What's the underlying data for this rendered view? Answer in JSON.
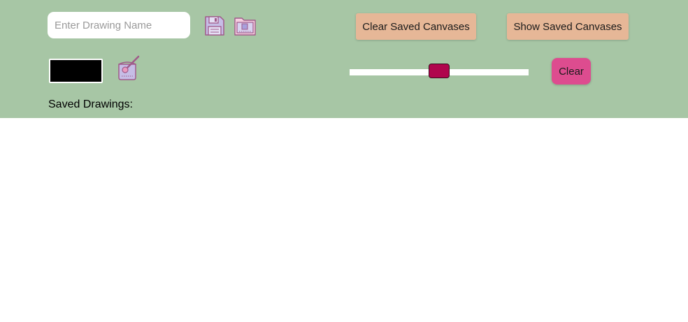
{
  "toolbar": {
    "name_input": {
      "value": "",
      "placeholder": "Enter Drawing Name"
    },
    "save_icon": "floppy-disk-icon",
    "load_icon": "open-folder-icon",
    "clear_saved_label": "Clear Saved Canvases",
    "show_saved_label": "Show Saved Canvases",
    "color_value": "#000000",
    "bucket_icon": "paint-bucket-icon",
    "brush_size_fraction": 0.5,
    "clear_label": "Clear",
    "saved_drawings_label": "Saved Drawings:"
  },
  "colors": {
    "toolbar_bg": "#a7c6a5",
    "peach_button": "#e6b797",
    "clear_button": "#dd4c8f",
    "slider_thumb": "#b0064d",
    "icon_fill": "#c6bde6",
    "icon_stroke": "#a05a8a"
  },
  "saved_drawings": []
}
